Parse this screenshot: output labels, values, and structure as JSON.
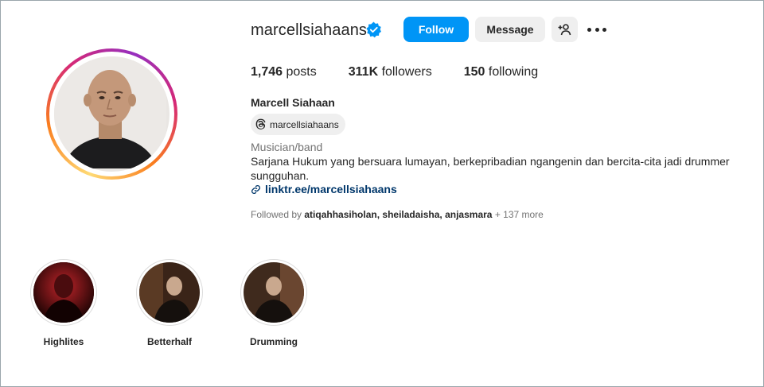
{
  "profile": {
    "username": "marcellsiahaans",
    "verified": true,
    "follow_label": "Follow",
    "message_label": "Message",
    "posts_count": "1,746",
    "posts_label": "posts",
    "followers_count": "311K",
    "followers_label": "followers",
    "following_count": "150",
    "following_label": "following",
    "full_name": "Marcell Siahaan",
    "threads_handle": "marcellsiahaans",
    "category": "Musician/band",
    "bio": "Sarjana Hukum yang bersuara lumayan, berkepribadian ngangenin dan bercita-cita jadi drummer sungguhan.",
    "link": "linktr.ee/marcellsiahaans",
    "followed_by_prefix": "Followed by",
    "followed_by_names": "atiqahhasiholan, sheiladaisha, anjasmara",
    "followed_by_more": "+ 137 more"
  },
  "highlights": [
    {
      "label": "Highlites"
    },
    {
      "label": "Betterhalf"
    },
    {
      "label": "Drumming"
    }
  ],
  "colors": {
    "accent": "#0095f6",
    "link": "#00376b",
    "verified": "#0095f6",
    "button_secondary": "#efefef",
    "muted_text": "#737373"
  },
  "icons": {
    "verified": "verified-badge-icon",
    "add_user": "add-user-icon",
    "more": "more-options-icon",
    "threads": "threads-icon",
    "link": "link-icon"
  }
}
